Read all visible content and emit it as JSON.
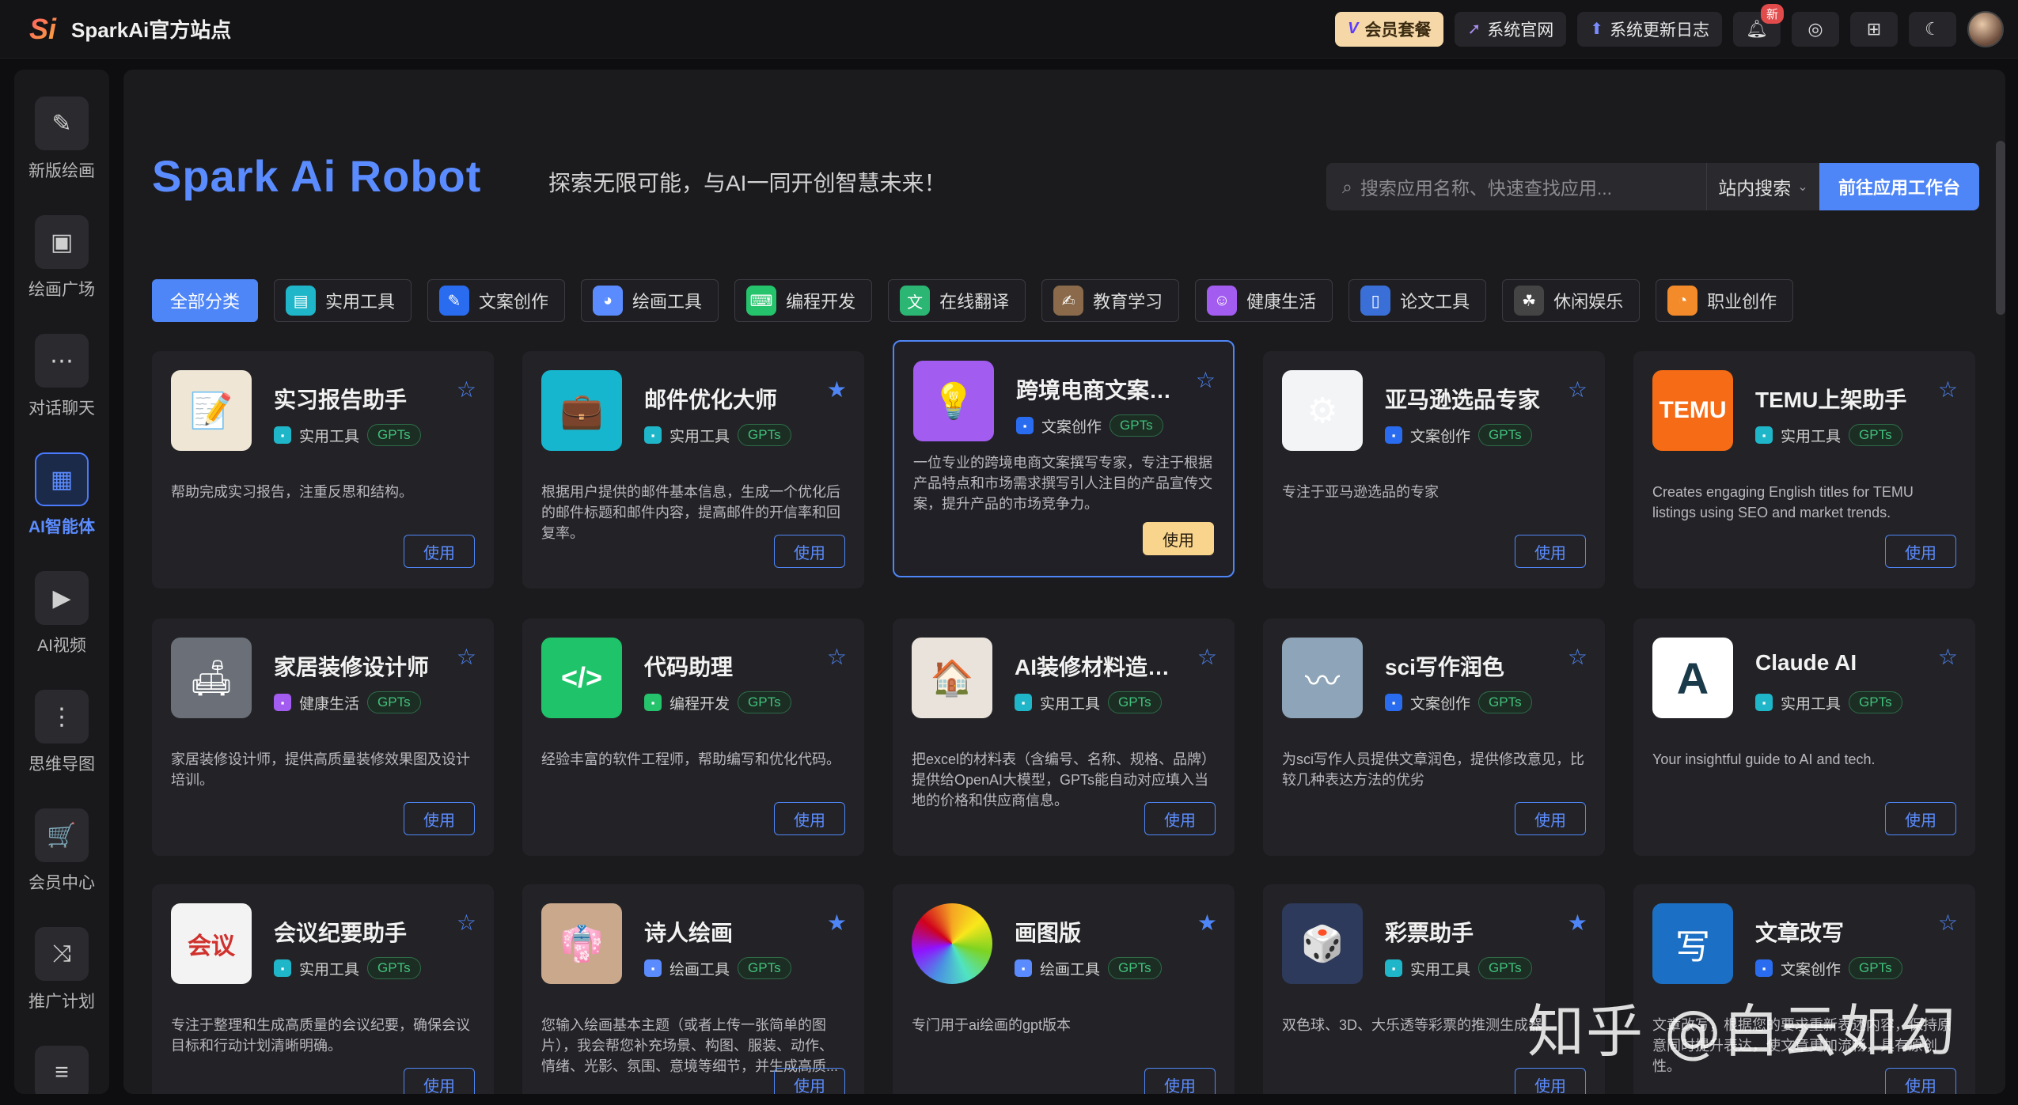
{
  "topbar": {
    "logo_text": "SparkAi官方站点",
    "vip_label": "会员套餐",
    "official_label": "系统官网",
    "changelog_label": "系统更新日志",
    "notify_badge": "新"
  },
  "sidebar": {
    "items": [
      {
        "label": "新版绘画",
        "icon": "✎"
      },
      {
        "label": "绘画广场",
        "icon": "▣"
      },
      {
        "label": "对话聊天",
        "icon": "⋯"
      },
      {
        "label": "AI智能体",
        "icon": "▦"
      },
      {
        "label": "AI视频",
        "icon": "▶"
      },
      {
        "label": "思维导图",
        "icon": "⋮"
      },
      {
        "label": "会员中心",
        "icon": "🛒"
      },
      {
        "label": "推广计划",
        "icon": "⤨"
      }
    ]
  },
  "hero": {
    "title": "Spark Ai Robot",
    "subtitle": "探索无限可能，与AI一同开创智慧未来！"
  },
  "search": {
    "placeholder": "搜索应用名称、快速查找应用...",
    "scope": "站内搜索",
    "goto_label": "前往应用工作台"
  },
  "categories": [
    {
      "label": "全部分类",
      "color": ""
    },
    {
      "label": "实用工具",
      "color": "#1fb6c9",
      "icon": "▤"
    },
    {
      "label": "文案创作",
      "color": "#2a6cf0",
      "icon": "✎"
    },
    {
      "label": "绘画工具",
      "color": "#5b8cff",
      "icon": "◕"
    },
    {
      "label": "编程开发",
      "color": "#25c36b",
      "icon": "⌨"
    },
    {
      "label": "在线翻译",
      "color": "#2bb673",
      "icon": "文"
    },
    {
      "label": "教育学习",
      "color": "#8a6a4a",
      "icon": "✍"
    },
    {
      "label": "健康生活",
      "color": "#a25cf0",
      "icon": "☺"
    },
    {
      "label": "论文工具",
      "color": "#3b6fd8",
      "icon": "▯"
    },
    {
      "label": "休闲娱乐",
      "color": "#444",
      "icon": "☘"
    },
    {
      "label": "职业创作",
      "color": "#f38b2a",
      "icon": "◔"
    }
  ],
  "cards": [
    {
      "title": "实习报告助手",
      "tag": "实用工具",
      "tag_color": "#1fb6c9",
      "gpts": "GPTs",
      "desc": "帮助完成实习报告，注重反思和结构。",
      "starred": false,
      "img": "📝",
      "img_bg": "#efe6d6",
      "use": "使用"
    },
    {
      "title": "邮件优化大师",
      "tag": "实用工具",
      "tag_color": "#1fb6c9",
      "gpts": "GPTs",
      "desc": "根据用户提供的邮件基本信息，生成一个优化后的邮件标题和邮件内容，提高邮件的开信率和回复率。",
      "starred": true,
      "img": "💼",
      "img_bg": "#17b6cf",
      "use": "使用"
    },
    {
      "title": "跨境电商文案撰写专家",
      "tag": "文案创作",
      "tag_color": "#2a6cf0",
      "gpts": "GPTs",
      "desc": "一位专业的跨境电商文案撰写专家，专注于根据产品特点和市场需求撰写引人注目的产品宣传文案，提升产品的市场竞争力。",
      "starred": false,
      "img": "💡",
      "img_bg": "#a25cf0",
      "use": "使用"
    },
    {
      "title": "亚马逊选品专家",
      "tag": "文案创作",
      "tag_color": "#2a6cf0",
      "gpts": "GPTs",
      "desc": "专注于亚马逊选品的专家",
      "starred": false,
      "img": "⚙",
      "img_bg": "#f2f4f6",
      "use": "使用"
    },
    {
      "title": "TEMU上架助手",
      "tag": "实用工具",
      "tag_color": "#1fb6c9",
      "gpts": "GPTs",
      "desc": "Creates engaging English titles for TEMU listings using SEO and market trends.",
      "starred": false,
      "img": "TEMU",
      "img_bg": "#f56b16",
      "use": "使用"
    },
    {
      "title": "家居装修设计师",
      "tag": "健康生活",
      "tag_color": "#a25cf0",
      "gpts": "GPTs",
      "desc": "家居装修设计师，提供高质量装修效果图及设计培训。",
      "starred": false,
      "img": "🛋",
      "img_bg": "#6b7078",
      "use": "使用"
    },
    {
      "title": "代码助理",
      "tag": "编程开发",
      "tag_color": "#25c36b",
      "gpts": "GPTs",
      "desc": "经验丰富的软件工程师，帮助编写和优化代码。",
      "starred": false,
      "img": "</>",
      "img_bg": "#1fc46a",
      "use": "使用"
    },
    {
      "title": "AI装修材料造价专家",
      "tag": "实用工具",
      "tag_color": "#1fb6c9",
      "gpts": "GPTs",
      "desc": "把excel的材料表（含编号、名称、规格、品牌）提供给OpenAI大模型，GPTs能自动对应填入当地的价格和供应商信息。",
      "starred": false,
      "img": "🏠",
      "img_bg": "#e9e3dc",
      "use": "使用"
    },
    {
      "title": "sci写作润色",
      "tag": "文案创作",
      "tag_color": "#2a6cf0",
      "gpts": "GPTs",
      "desc": "为sci写作人员提供文章润色，提供修改意见，比较几种表达方法的优劣",
      "starred": false,
      "img": "〰",
      "img_bg": "#8ea4b8",
      "use": "使用"
    },
    {
      "title": "Claude AI",
      "tag": "实用工具",
      "tag_color": "#1fb6c9",
      "gpts": "GPTs",
      "desc": "Your insightful guide to AI and tech.",
      "starred": false,
      "img": "A",
      "img_bg": "#ffffff",
      "use": "使用"
    },
    {
      "title": "会议纪要助手",
      "tag": "实用工具",
      "tag_color": "#1fb6c9",
      "gpts": "GPTs",
      "desc": "专注于整理和生成高质量的会议纪要，确保会议目标和行动计划清晰明确。",
      "starred": false,
      "img": "会议",
      "img_bg": "#f3f3f3",
      "use": "使用"
    },
    {
      "title": "诗人绘画",
      "tag": "绘画工具",
      "tag_color": "#5b8cff",
      "gpts": "GPTs",
      "desc": "您输入绘画基本主题（或者上传一张简单的图片），我会帮您补充场景、构图、服装、动作、情绪、光影、氛围、意境等细节，并生成高质...",
      "starred": true,
      "img": "👘",
      "img_bg": "#c9a88c",
      "use": "使用"
    },
    {
      "title": "画图版",
      "tag": "绘画工具",
      "tag_color": "#5b8cff",
      "gpts": "GPTs",
      "desc": "专门用于ai绘画的gpt版本",
      "starred": true,
      "img": "",
      "img_bg": "conic",
      "use": "使用"
    },
    {
      "title": "彩票助手",
      "tag": "实用工具",
      "tag_color": "#1fb6c9",
      "gpts": "GPTs",
      "desc": "双色球、3D、大乐透等彩票的推测生成器",
      "starred": true,
      "img": "🎲",
      "img_bg": "#2d3a5c",
      "use": "使用"
    },
    {
      "title": "文章改写",
      "tag": "文案创作",
      "tag_color": "#2a6cf0",
      "gpts": "GPTs",
      "desc": "文章改写，根据您的要求重新表述内容，保持原意同时提升表达，使文章更加流畅，具有原创性。",
      "starred": false,
      "img": "写",
      "img_bg": "#1b6fc4",
      "use": "使用"
    }
  ],
  "watermark": "知乎 @白云如幻"
}
